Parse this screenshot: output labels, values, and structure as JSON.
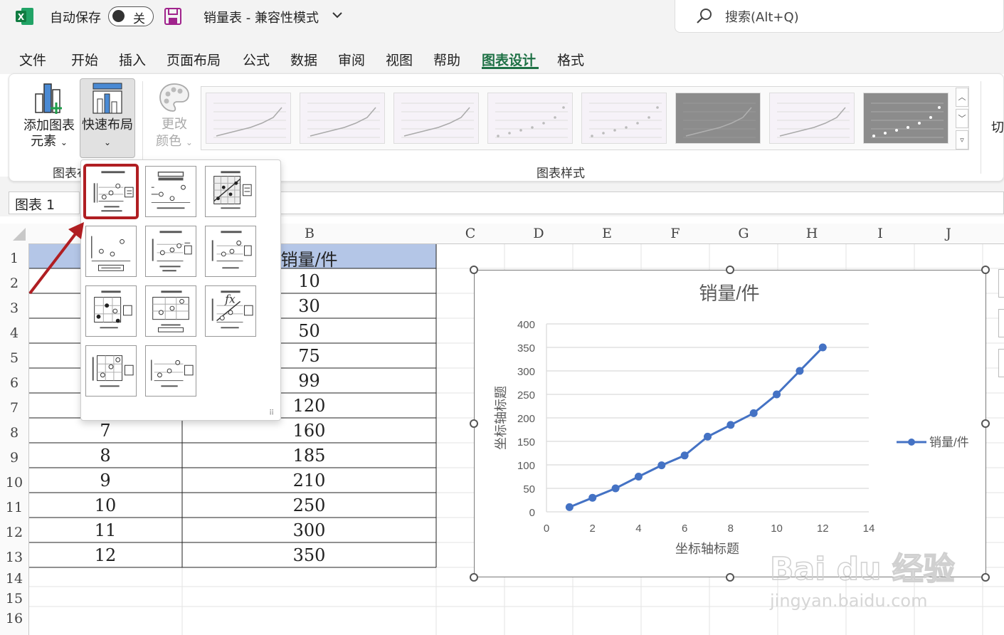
{
  "titlebar": {
    "autosave_label": "自动保存",
    "autosave_state": "关",
    "document_title": "销量表  -  兼容性模式",
    "search_placeholder": "搜索(Alt+Q)"
  },
  "menu": {
    "tabs": [
      {
        "label": "文件"
      },
      {
        "label": "开始"
      },
      {
        "label": "插入"
      },
      {
        "label": "页面布局"
      },
      {
        "label": "公式"
      },
      {
        "label": "数据"
      },
      {
        "label": "审阅"
      },
      {
        "label": "视图"
      },
      {
        "label": "帮助"
      },
      {
        "label": "图表设计",
        "active": true
      },
      {
        "label": "格式"
      }
    ]
  },
  "ribbon": {
    "add_element_label_1": "添加图表",
    "add_element_label_2": "元素",
    "quick_layout_label": "快速布局",
    "change_colors_label_1": "更改",
    "change_colors_label_2": "颜色",
    "group_layout_label": "图表布",
    "group_styles_label": "图表样式",
    "overflow_label": "切"
  },
  "namebox": {
    "value": "图表 1"
  },
  "sheet": {
    "columns": [
      "B",
      "C",
      "D",
      "E",
      "F",
      "G",
      "H",
      "I",
      "J"
    ],
    "rows": [
      "1",
      "2",
      "3",
      "4",
      "5",
      "6",
      "7",
      "8",
      "9",
      "10",
      "11",
      "12",
      "13",
      "14",
      "15",
      "16"
    ],
    "header_b": "销量/件",
    "col_a_values": [
      "7",
      "8",
      "9",
      "10",
      "11",
      "12"
    ],
    "col_b_values": [
      "10",
      "30",
      "50",
      "75",
      "99",
      "120",
      "160",
      "185",
      "210",
      "250",
      "300",
      "350"
    ]
  },
  "chart_data": {
    "type": "line",
    "title": "销量/件",
    "xlabel": "坐标轴标题",
    "ylabel": "坐标轴标题",
    "xlim": [
      0,
      14
    ],
    "ylim": [
      0,
      400
    ],
    "x_ticks": [
      "0",
      "2",
      "4",
      "6",
      "8",
      "10",
      "12",
      "14"
    ],
    "y_ticks": [
      "0",
      "50",
      "100",
      "150",
      "200",
      "250",
      "300",
      "350",
      "400"
    ],
    "grid": "horizontal",
    "legend_position": "right",
    "series": [
      {
        "name": "销量/件",
        "color": "#4472c4",
        "x": [
          1,
          2,
          3,
          4,
          5,
          6,
          7,
          8,
          9,
          10,
          11,
          12
        ],
        "y": [
          10,
          30,
          50,
          75,
          99,
          120,
          160,
          185,
          210,
          250,
          300,
          350
        ]
      }
    ]
  },
  "watermark": {
    "brand": "Bai du 经验",
    "url": "jingyan.baidu.com"
  },
  "colors": {
    "excel_green": "#1e7145",
    "header_fill": "#b4c6e7",
    "selected_border": "#b01e22",
    "arrow": "#b01e22"
  }
}
